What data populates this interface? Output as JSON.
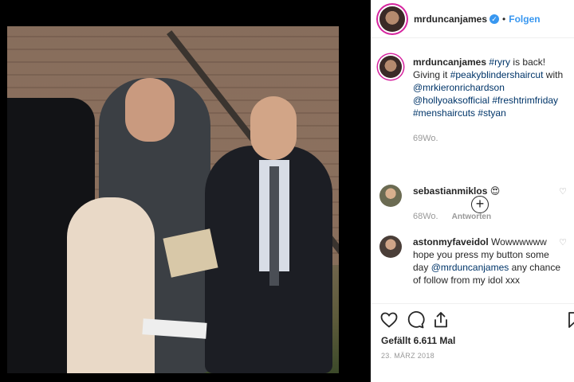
{
  "post": {
    "photo_alt": "photo",
    "author": "mrduncanjames",
    "verified_mark": "✓",
    "separator": "•",
    "follow_label": "Folgen"
  },
  "caption": {
    "author": "mrduncanjames",
    "parts": [
      "#ryry",
      "is back! Giving it",
      "#peakyblindershaircut",
      "with",
      "@mrkieronrichardson",
      "@hollyoaksofficial",
      "#freshtrimfriday",
      "#menshaircuts",
      "#styan"
    ],
    "time": "69Wo."
  },
  "load_more_label": "+",
  "comments": [
    {
      "author": "sebastianmiklos",
      "text": "😍",
      "time": "68Wo.",
      "reply_label": "Antworten"
    },
    {
      "author": "astonmyfaveidol",
      "text": "Wowwwwww hope you press my button some day",
      "mention": "@mrduncanjames",
      "text2": "any chance of follow from my idol xxx"
    }
  ],
  "actions": {
    "likes": "Gefällt 6.611 Mal",
    "date": "23. MÄRZ 2018"
  },
  "colors": {
    "accent": "#3897f0",
    "hashtag": "#003569",
    "muted": "#999999",
    "text": "#262626"
  }
}
